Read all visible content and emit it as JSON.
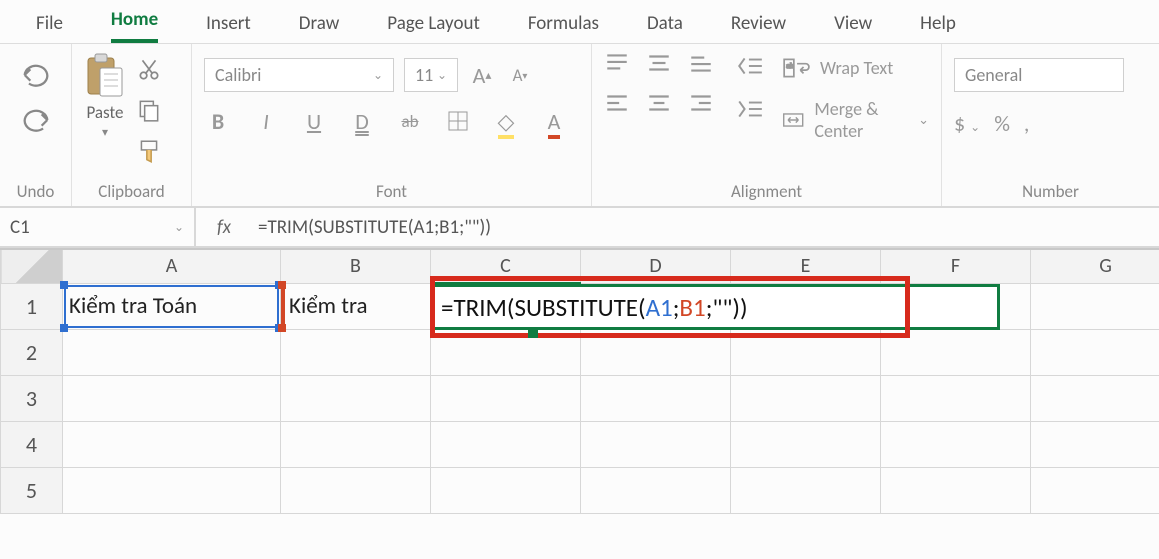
{
  "tabs": {
    "file": "File",
    "home": "Home",
    "insert": "Insert",
    "draw": "Draw",
    "pagelayout": "Page Layout",
    "formulas": "Formulas",
    "data": "Data",
    "review": "Review",
    "view": "View",
    "help": "Help",
    "active": "home"
  },
  "ribbon": {
    "undo_label": "Undo",
    "paste_label": "Paste",
    "clipboard_label": "Clipboard",
    "font_name": "Calibri",
    "font_size": "11",
    "font_label": "Font",
    "wrap_text": "Wrap Text",
    "merge_center": "Merge & Center",
    "alignment_label": "Alignment",
    "number_format": "General",
    "number_label": "Number",
    "buttons": {
      "bold": "B",
      "italic": "I",
      "underline": "U",
      "double_underline": "D",
      "strike": "ab"
    }
  },
  "formula_bar": {
    "active_cell": "C1",
    "fx": "fx",
    "formula_plain": "=TRIM(SUBSTITUTE(A1;B1;\"\"))"
  },
  "columns": [
    "A",
    "B",
    "C",
    "D",
    "E",
    "F",
    "G"
  ],
  "rows": [
    "1",
    "2",
    "3",
    "4",
    "5"
  ],
  "cells": {
    "A1": "Kiểm tra Toán",
    "B1": "Kiểm tra"
  },
  "cell_formula": {
    "pre": "=TRIM(SUBSTITUTE(",
    "a": "A1",
    "sep1": ";",
    "b": "B1",
    "post": ";\"\"))"
  }
}
